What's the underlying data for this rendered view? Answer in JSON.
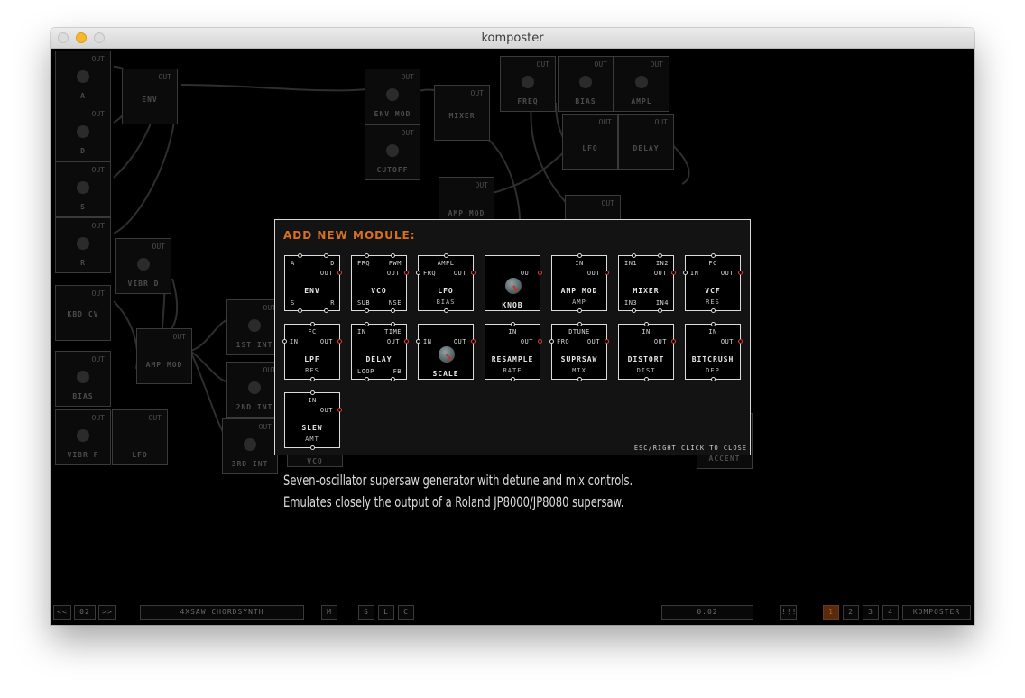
{
  "window": {
    "title": "komposter"
  },
  "background_modules": [
    {
      "label": "A",
      "ports": "OUT"
    },
    {
      "label": "D",
      "ports": "OUT"
    },
    {
      "label": "S",
      "ports": "OUT"
    },
    {
      "label": "R",
      "ports": "OUT"
    },
    {
      "label": "ENV",
      "ports": "A D OUT S R"
    },
    {
      "label": "VIBR D",
      "ports": "OUT"
    },
    {
      "label": "KBD CV",
      "ports": "OUT"
    },
    {
      "label": "BIAS",
      "ports": "OUT"
    },
    {
      "label": "VIBR F",
      "ports": "OUT"
    },
    {
      "label": "LFO",
      "ports": "AMPL FRQ OUT BIAS"
    },
    {
      "label": "AMP MOD",
      "ports": "IN OUT AMP"
    },
    {
      "label": "1ST INT",
      "ports": "IN OUT"
    },
    {
      "label": "2ND INT",
      "ports": "IN OUT"
    },
    {
      "label": "3RD INT",
      "ports": "IN OUT"
    },
    {
      "label": "ENV MOD",
      "ports": "IN OUT"
    },
    {
      "label": "CUTOFF",
      "ports": "OUT"
    },
    {
      "label": "MIXER",
      "ports": "IN1 IN2 OUT IN3 IN4"
    },
    {
      "label": "AMP MOD",
      "ports": "IN OUT"
    },
    {
      "label": "FREQ",
      "ports": "OUT"
    },
    {
      "label": "BIAS",
      "ports": "OUT"
    },
    {
      "label": "AMPL",
      "ports": "OUT"
    },
    {
      "label": "LFO",
      "ports": "AMPL FRQ OUT BIAS"
    },
    {
      "label": "DELAY",
      "ports": "IN TIME OUT LOOP FB"
    },
    {
      "label": "ACCENT",
      "ports": ""
    },
    {
      "label": "VCO",
      "ports": ""
    }
  ],
  "modal": {
    "title": "ADD NEW MODULE:",
    "close_hint": "ESC/RIGHT CLICK TO CLOSE",
    "modules": [
      {
        "name": "ENV",
        "top": [
          "A",
          "D"
        ],
        "right": "OUT",
        "bottom": [
          "S",
          "R"
        ]
      },
      {
        "name": "VCO",
        "top": [
          "FRQ",
          "PWM"
        ],
        "right": "OUT",
        "bottom": [
          "SUB",
          "NSE"
        ]
      },
      {
        "name": "LFO",
        "top": [
          "AMPL"
        ],
        "left": "FRQ",
        "right": "OUT",
        "bottom": [
          "BIAS"
        ]
      },
      {
        "name": "KNOB",
        "right": "OUT",
        "knob": true
      },
      {
        "name": "AMP MOD",
        "top": [
          "IN"
        ],
        "right": "OUT",
        "bottom": [
          "AMP"
        ]
      },
      {
        "name": "MIXER",
        "top": [
          "IN1",
          "IN2"
        ],
        "right": "OUT",
        "bottom": [
          "IN3",
          "IN4"
        ]
      },
      {
        "name": "VCF",
        "top": [
          "FC"
        ],
        "left": "IN",
        "right": "OUT",
        "bottom": [
          "RES"
        ]
      },
      {
        "name": "LPF",
        "top": [
          "FC"
        ],
        "left": "IN",
        "right": "OUT",
        "bottom": [
          "RES"
        ]
      },
      {
        "name": "DELAY",
        "top": [
          "IN",
          "TIME"
        ],
        "right": "OUT",
        "bottom": [
          "LOOP",
          "FB"
        ]
      },
      {
        "name": "SCALE",
        "left": "IN",
        "right": "OUT",
        "knob": true
      },
      {
        "name": "RESAMPLE",
        "top": [
          "IN"
        ],
        "right": "OUT",
        "bottom": [
          "RATE"
        ]
      },
      {
        "name": "SUPRSAW",
        "top": [
          "DTUNE"
        ],
        "left": "FRQ",
        "right": "OUT",
        "bottom": [
          "MIX"
        ]
      },
      {
        "name": "DISTORT",
        "top": [
          "IN"
        ],
        "right": "OUT",
        "bottom": [
          "DIST"
        ]
      },
      {
        "name": "BITCRUSH",
        "top": [
          "IN"
        ],
        "right": "OUT",
        "bottom": [
          "DEP"
        ]
      },
      {
        "name": "SLEW",
        "top": [
          "IN"
        ],
        "right": "OUT",
        "bottom": [
          "AMT"
        ]
      }
    ]
  },
  "description": {
    "line1": "Seven-oscillator supersaw generator with detune and mix controls.",
    "line2": "Emulates closely the output of a Roland JP8000/JP8080 supersaw."
  },
  "statusbar": {
    "prev": "<<",
    "page": "02",
    "next": ">>",
    "patch_name": "4XSAW CHORDSYNTH",
    "m": "M",
    "s": "S",
    "l": "L",
    "c": "C",
    "value": "0.02",
    "bang": "!!!",
    "slots": [
      "1",
      "2",
      "3",
      "4"
    ],
    "active_slot": "1",
    "app": "KOMPOSTER"
  },
  "colors": {
    "accent": "#d9701f",
    "output_port": "#e23a3a",
    "background": "#000000"
  }
}
